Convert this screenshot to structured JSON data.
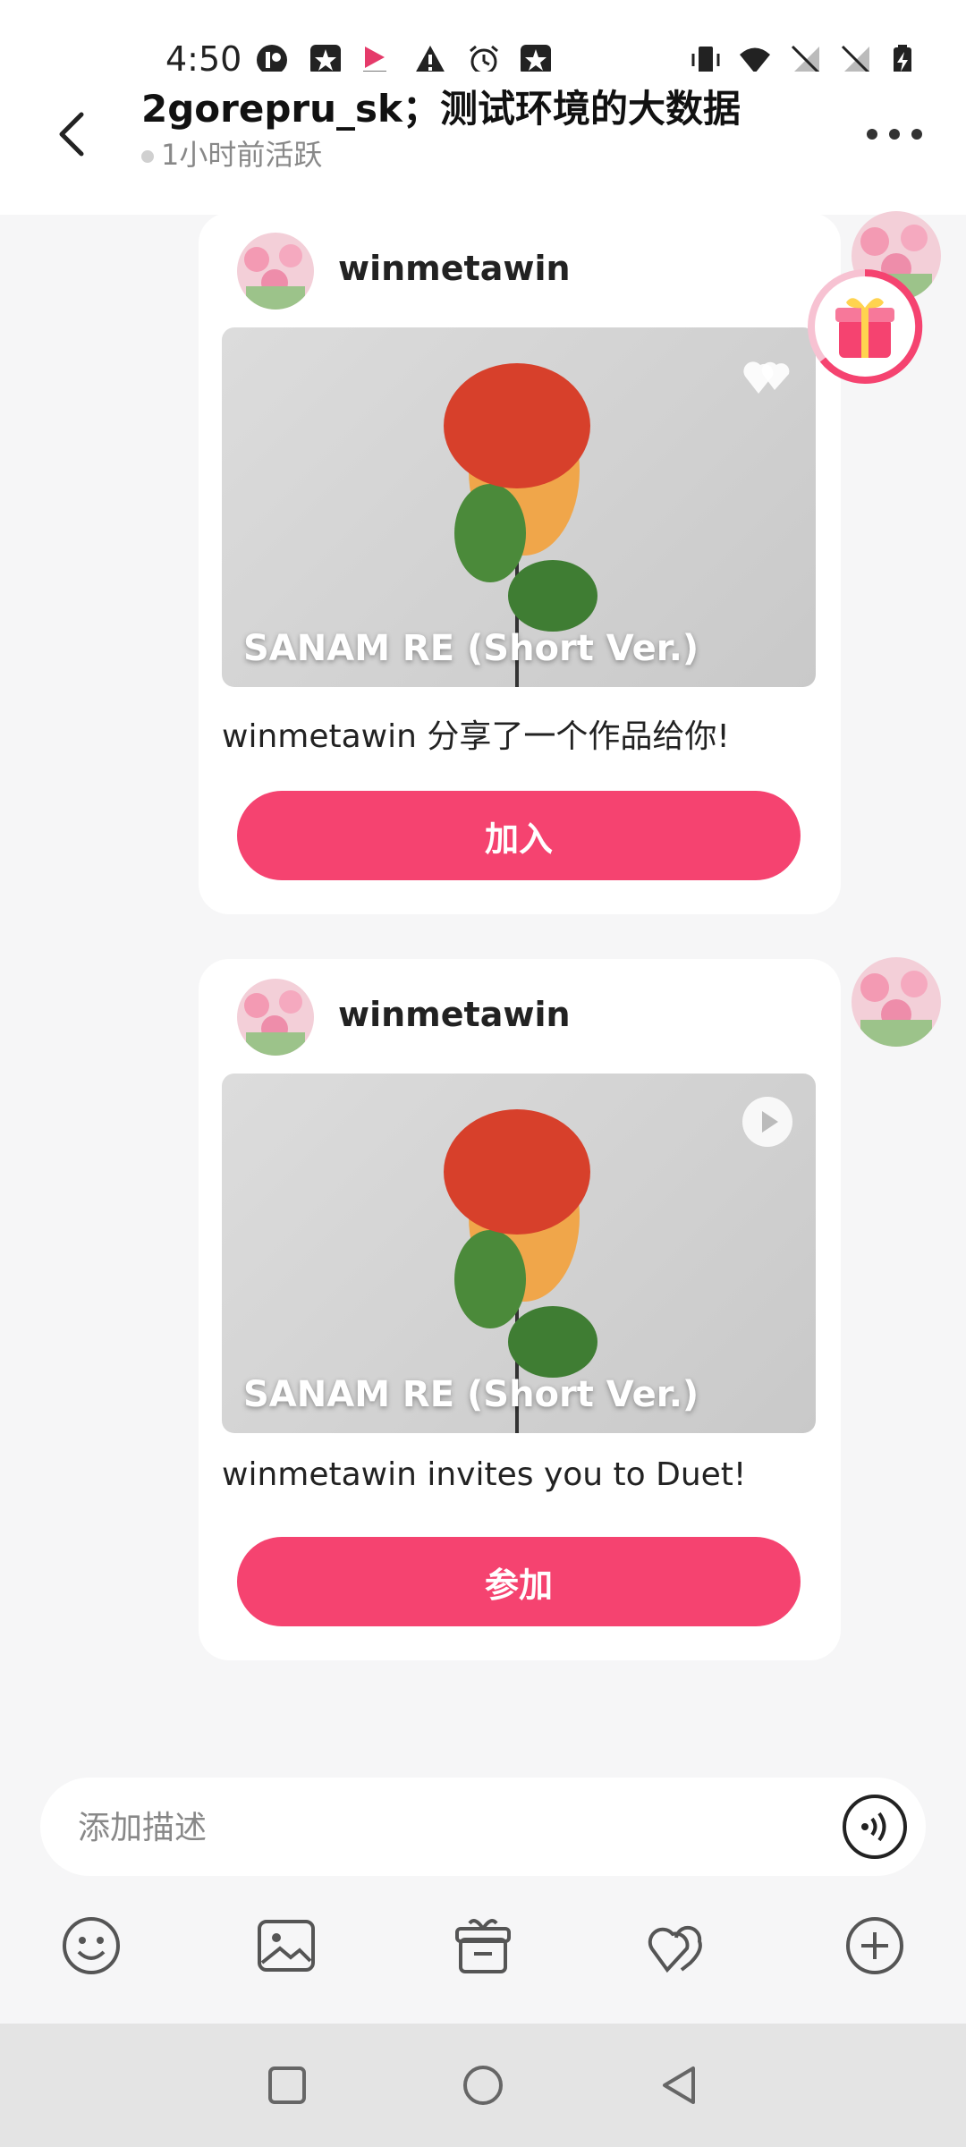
{
  "status": {
    "time": "4:50"
  },
  "header": {
    "title": "2gorepru_sk；测试环境的大数据",
    "status": "1小时前活跃"
  },
  "messages": [
    {
      "sender": "winmetawin",
      "song_title": "SANAM RE (Short Ver.)",
      "text": "winmetawin 分享了一个作品给你!",
      "button": "加入",
      "thumb_icon": "duet-hearts-icon"
    },
    {
      "sender": "winmetawin",
      "song_title": "SANAM RE (Short Ver.)",
      "text": "winmetawin invites you to Duet!",
      "button": "参加",
      "thumb_icon": "play-icon"
    }
  ],
  "input": {
    "placeholder": "添加描述"
  },
  "toolbar": [
    "emoji-icon",
    "image-icon",
    "gift-box-icon",
    "duet-icon",
    "plus-icon"
  ],
  "colors": {
    "accent": "#f54370",
    "background": "#f6f6f7"
  }
}
